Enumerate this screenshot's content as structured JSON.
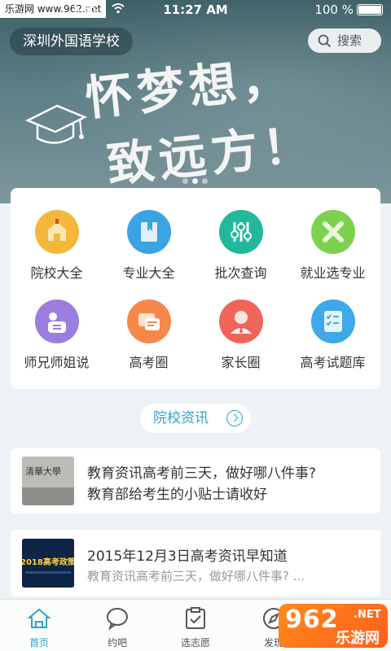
{
  "status_bar": {
    "watermark": "乐游网 www.962.net",
    "carrier": "ium",
    "time": "11:27 AM",
    "battery": "100 %"
  },
  "header": {
    "school_name": "深圳外国语学校",
    "search_label": "搜索"
  },
  "banner": {
    "line1": "怀梦想，",
    "line2": "致远方！",
    "dots_count": 3,
    "active_dot": 2
  },
  "grid": [
    {
      "label": "院校大全",
      "icon": "university-icon",
      "color": "#f4b73b"
    },
    {
      "label": "专业大全",
      "icon": "book-icon",
      "color": "#3aa3e3"
    },
    {
      "label": "批次查询",
      "icon": "sliders-icon",
      "color": "#22b89a"
    },
    {
      "label": "就业选专业",
      "icon": "tools-icon",
      "color": "#7ed04f"
    },
    {
      "label": "师兄师姐说",
      "icon": "chat-people-icon",
      "color": "#9b7de0"
    },
    {
      "label": "高考圈",
      "icon": "message-icon",
      "color": "#f5884a"
    },
    {
      "label": "家长圈",
      "icon": "parent-icon",
      "color": "#f0655a"
    },
    {
      "label": "高考试题库",
      "icon": "checklist-icon",
      "color": "#3fa8e8"
    }
  ],
  "section": {
    "title": "院校资讯"
  },
  "news": [
    {
      "title_line1": "教育资讯高考前三天，做好哪八件事?",
      "title_line2": "教育部给考生的小贴士请收好",
      "thumb_text": "清華大學"
    },
    {
      "title_line1": "2015年12月3日高考资讯早知道",
      "subtitle": "教育资讯高考前三天，做好哪八件事? ...",
      "thumb_text": "2018高考政策"
    }
  ],
  "tabs": [
    {
      "label": "首页",
      "icon": "home-icon",
      "active": true
    },
    {
      "label": "约吧",
      "icon": "chat-bubble-icon",
      "active": false
    },
    {
      "label": "选志愿",
      "icon": "clipboard-check-icon",
      "active": false
    },
    {
      "label": "发现",
      "icon": "compass-icon",
      "active": false
    }
  ],
  "watermark_badge": {
    "text": "962",
    "suffix": ".NET",
    "sub": "乐游网"
  },
  "colors": {
    "accent": "#2aa6c9"
  }
}
